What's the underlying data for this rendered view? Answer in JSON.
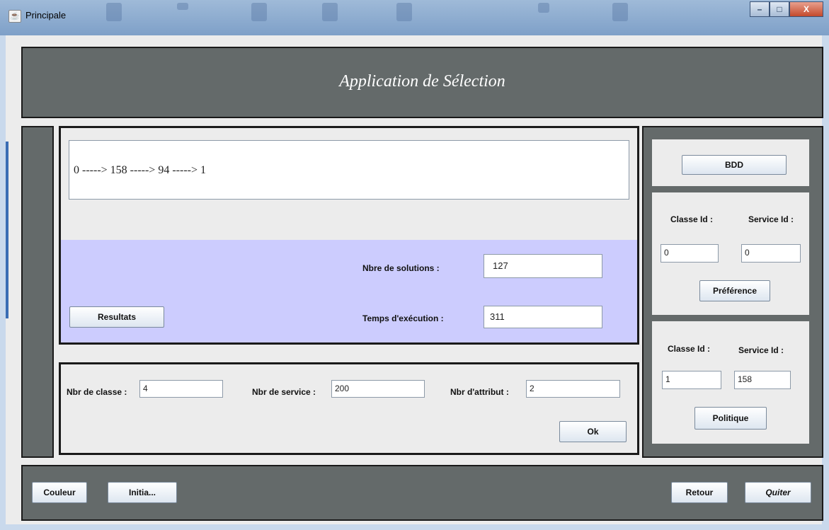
{
  "window": {
    "title": "Principale",
    "controls": {
      "minimize": "–",
      "maximize": "□",
      "close": "X"
    }
  },
  "header": {
    "title": "Application de Sélection"
  },
  "result": {
    "path_text": "0  -----> 158  -----> 94  -----> 1"
  },
  "stats": {
    "solutions_label": "Nbre de solutions :",
    "solutions_value": "127",
    "time_label": "Temps d'exécution :",
    "time_value": "311",
    "resultats_button": "Resultats"
  },
  "params": {
    "classe_label": "Nbr de classe :",
    "classe_value": "4",
    "service_label": "Nbr de service :",
    "service_value": "200",
    "attribut_label": "Nbr d'attribut :",
    "attribut_value": "2",
    "ok_button": "Ok"
  },
  "right": {
    "bdd_button": "BDD",
    "pref": {
      "classe_label": "Classe Id :",
      "service_label": "Service Id :",
      "classe_value": "0",
      "service_value": "0",
      "button": "Préférence"
    },
    "pol": {
      "classe_label": "Classe Id :",
      "service_label": "Service Id :",
      "classe_value": "1",
      "service_value": "158",
      "button": "Politique"
    }
  },
  "footer": {
    "couleur": "Couleur",
    "initia": "Initia...",
    "retour": "Retour",
    "quiter": "Quiter"
  }
}
